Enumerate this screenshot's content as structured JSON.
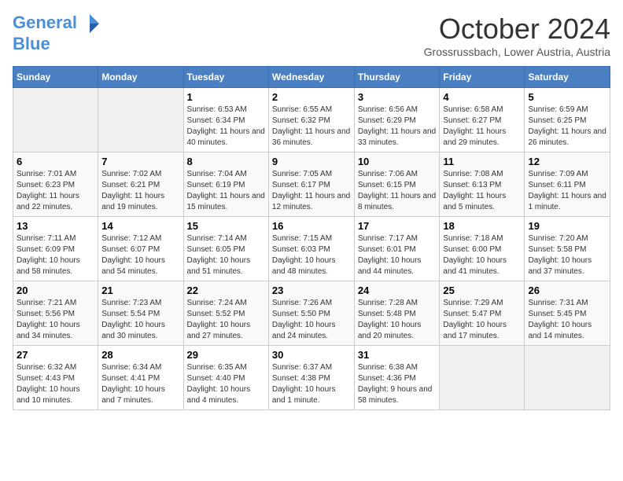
{
  "header": {
    "logo_line1": "General",
    "logo_line2": "Blue",
    "month_title": "October 2024",
    "location": "Grossrussbach, Lower Austria, Austria"
  },
  "weekdays": [
    "Sunday",
    "Monday",
    "Tuesday",
    "Wednesday",
    "Thursday",
    "Friday",
    "Saturday"
  ],
  "weeks": [
    [
      {
        "day": "",
        "info": ""
      },
      {
        "day": "",
        "info": ""
      },
      {
        "day": "1",
        "info": "Sunrise: 6:53 AM\nSunset: 6:34 PM\nDaylight: 11 hours and 40 minutes."
      },
      {
        "day": "2",
        "info": "Sunrise: 6:55 AM\nSunset: 6:32 PM\nDaylight: 11 hours and 36 minutes."
      },
      {
        "day": "3",
        "info": "Sunrise: 6:56 AM\nSunset: 6:29 PM\nDaylight: 11 hours and 33 minutes."
      },
      {
        "day": "4",
        "info": "Sunrise: 6:58 AM\nSunset: 6:27 PM\nDaylight: 11 hours and 29 minutes."
      },
      {
        "day": "5",
        "info": "Sunrise: 6:59 AM\nSunset: 6:25 PM\nDaylight: 11 hours and 26 minutes."
      }
    ],
    [
      {
        "day": "6",
        "info": "Sunrise: 7:01 AM\nSunset: 6:23 PM\nDaylight: 11 hours and 22 minutes."
      },
      {
        "day": "7",
        "info": "Sunrise: 7:02 AM\nSunset: 6:21 PM\nDaylight: 11 hours and 19 minutes."
      },
      {
        "day": "8",
        "info": "Sunrise: 7:04 AM\nSunset: 6:19 PM\nDaylight: 11 hours and 15 minutes."
      },
      {
        "day": "9",
        "info": "Sunrise: 7:05 AM\nSunset: 6:17 PM\nDaylight: 11 hours and 12 minutes."
      },
      {
        "day": "10",
        "info": "Sunrise: 7:06 AM\nSunset: 6:15 PM\nDaylight: 11 hours and 8 minutes."
      },
      {
        "day": "11",
        "info": "Sunrise: 7:08 AM\nSunset: 6:13 PM\nDaylight: 11 hours and 5 minutes."
      },
      {
        "day": "12",
        "info": "Sunrise: 7:09 AM\nSunset: 6:11 PM\nDaylight: 11 hours and 1 minute."
      }
    ],
    [
      {
        "day": "13",
        "info": "Sunrise: 7:11 AM\nSunset: 6:09 PM\nDaylight: 10 hours and 58 minutes."
      },
      {
        "day": "14",
        "info": "Sunrise: 7:12 AM\nSunset: 6:07 PM\nDaylight: 10 hours and 54 minutes."
      },
      {
        "day": "15",
        "info": "Sunrise: 7:14 AM\nSunset: 6:05 PM\nDaylight: 10 hours and 51 minutes."
      },
      {
        "day": "16",
        "info": "Sunrise: 7:15 AM\nSunset: 6:03 PM\nDaylight: 10 hours and 48 minutes."
      },
      {
        "day": "17",
        "info": "Sunrise: 7:17 AM\nSunset: 6:01 PM\nDaylight: 10 hours and 44 minutes."
      },
      {
        "day": "18",
        "info": "Sunrise: 7:18 AM\nSunset: 6:00 PM\nDaylight: 10 hours and 41 minutes."
      },
      {
        "day": "19",
        "info": "Sunrise: 7:20 AM\nSunset: 5:58 PM\nDaylight: 10 hours and 37 minutes."
      }
    ],
    [
      {
        "day": "20",
        "info": "Sunrise: 7:21 AM\nSunset: 5:56 PM\nDaylight: 10 hours and 34 minutes."
      },
      {
        "day": "21",
        "info": "Sunrise: 7:23 AM\nSunset: 5:54 PM\nDaylight: 10 hours and 30 minutes."
      },
      {
        "day": "22",
        "info": "Sunrise: 7:24 AM\nSunset: 5:52 PM\nDaylight: 10 hours and 27 minutes."
      },
      {
        "day": "23",
        "info": "Sunrise: 7:26 AM\nSunset: 5:50 PM\nDaylight: 10 hours and 24 minutes."
      },
      {
        "day": "24",
        "info": "Sunrise: 7:28 AM\nSunset: 5:48 PM\nDaylight: 10 hours and 20 minutes."
      },
      {
        "day": "25",
        "info": "Sunrise: 7:29 AM\nSunset: 5:47 PM\nDaylight: 10 hours and 17 minutes."
      },
      {
        "day": "26",
        "info": "Sunrise: 7:31 AM\nSunset: 5:45 PM\nDaylight: 10 hours and 14 minutes."
      }
    ],
    [
      {
        "day": "27",
        "info": "Sunrise: 6:32 AM\nSunset: 4:43 PM\nDaylight: 10 hours and 10 minutes."
      },
      {
        "day": "28",
        "info": "Sunrise: 6:34 AM\nSunset: 4:41 PM\nDaylight: 10 hours and 7 minutes."
      },
      {
        "day": "29",
        "info": "Sunrise: 6:35 AM\nSunset: 4:40 PM\nDaylight: 10 hours and 4 minutes."
      },
      {
        "day": "30",
        "info": "Sunrise: 6:37 AM\nSunset: 4:38 PM\nDaylight: 10 hours and 1 minute."
      },
      {
        "day": "31",
        "info": "Sunrise: 6:38 AM\nSunset: 4:36 PM\nDaylight: 9 hours and 58 minutes."
      },
      {
        "day": "",
        "info": ""
      },
      {
        "day": "",
        "info": ""
      }
    ]
  ]
}
